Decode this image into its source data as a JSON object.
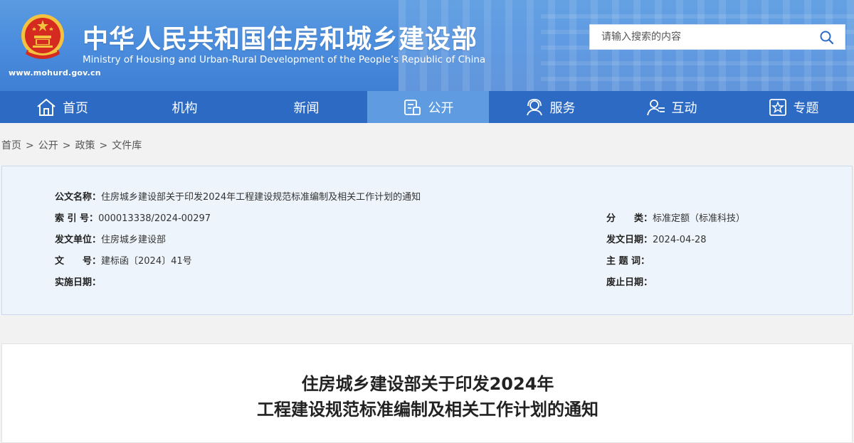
{
  "header": {
    "title": "中华人民共和国住房和城乡建设部",
    "subtitle": "Ministry of Housing and Urban-Rural Development of the People’s Republic of China",
    "url": "www.mohurd.gov.cn",
    "search_placeholder": "请输入搜索的内容"
  },
  "nav": {
    "items": [
      {
        "label": "首页",
        "icon": "home-icon"
      },
      {
        "label": "机构"
      },
      {
        "label": "新闻"
      },
      {
        "label": "公开",
        "icon": "document-icon",
        "active": true
      },
      {
        "label": "服务",
        "icon": "service-icon"
      },
      {
        "label": "互动",
        "icon": "interaction-icon"
      },
      {
        "label": "专题",
        "icon": "star-icon"
      }
    ]
  },
  "breadcrumb": [
    "首页",
    "公开",
    "政策",
    "文件库"
  ],
  "breadcrumb_sep": ">",
  "doc_info": {
    "name_label": "公文名称：",
    "name_value": "住房城乡建设部关于印发2024年工程建设规范标准编制及相关工作计划的通知",
    "index_label": "索 引 号：",
    "index_value": "000013338/2024-00297",
    "category_label": "分　　类：",
    "category_value": "标准定额（标准科技）",
    "issuer_label": "发文单位：",
    "issuer_value": "住房城乡建设部",
    "date_label": "发文日期：",
    "date_value": "2024-04-28",
    "number_label": "文　　号：",
    "number_value": "建标函〔2024〕41号",
    "topic_label": "主 题 词：",
    "topic_value": "",
    "effective_label": "实施日期：",
    "effective_value": "",
    "repeal_label": "废止日期：",
    "repeal_value": ""
  },
  "article": {
    "title_line1": "住房城乡建设部关于印发2024年",
    "title_line2": "工程建设规范标准编制及相关工作计划的通知"
  },
  "colors": {
    "header_blue": "#4c8ede",
    "nav_blue": "#2c6ac4",
    "nav_active": "#5f9be0",
    "emblem_red": "#d42a1f",
    "emblem_gold": "#f3c340"
  }
}
